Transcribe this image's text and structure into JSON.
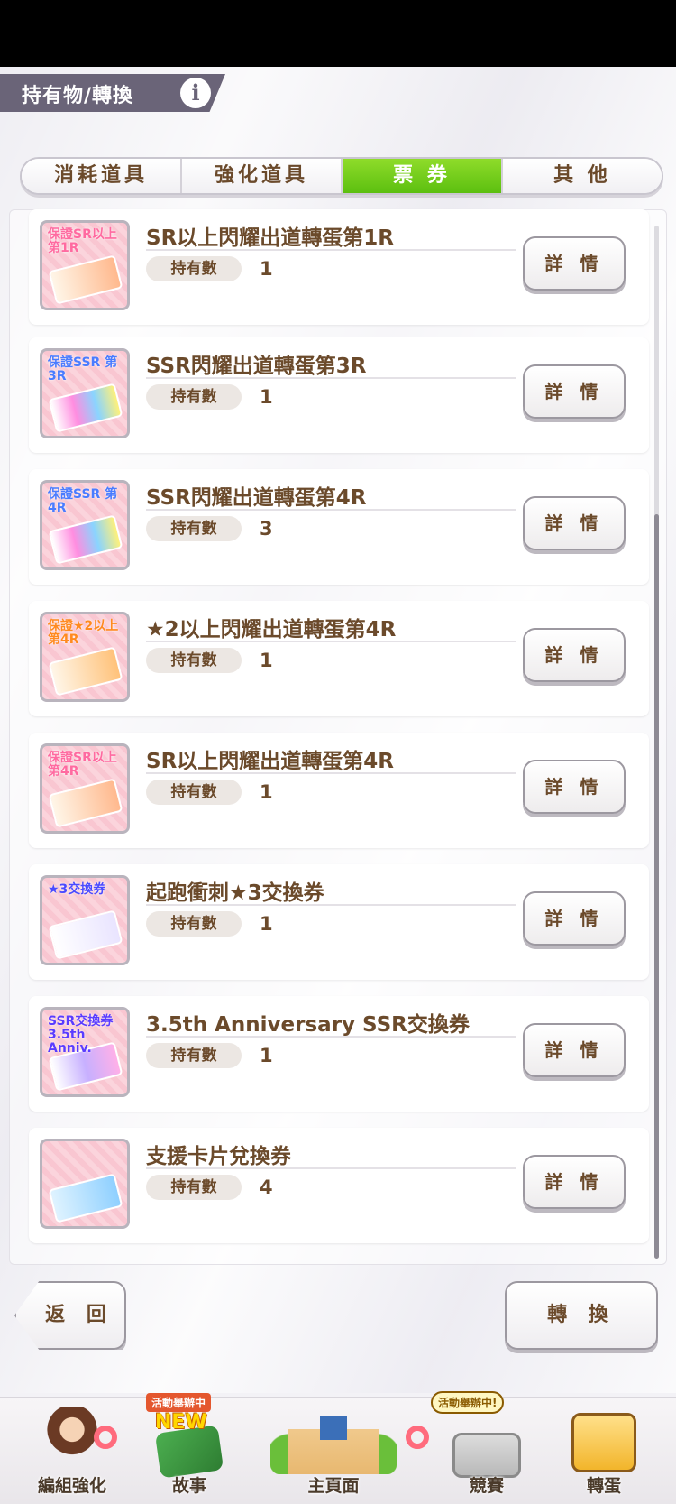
{
  "header": {
    "title": "持有物/轉換",
    "info_icon": "i"
  },
  "tabs": [
    {
      "label": "消耗道具",
      "active": false
    },
    {
      "label": "強化道具",
      "active": false
    },
    {
      "label": "票 券",
      "active": true
    },
    {
      "label": "其 他",
      "active": false
    }
  ],
  "items": [
    {
      "name": "SR以上閃耀出道轉蛋第1R",
      "qty_label": "持有數",
      "qty": "1",
      "detail": "詳 情",
      "thumb": "保證SR以上 第1R",
      "thumb_color": "#ff9f8a"
    },
    {
      "name": "SSR閃耀出道轉蛋第3R",
      "qty_label": "持有數",
      "qty": "1",
      "detail": "詳 情",
      "thumb": "保證SSR 第3R",
      "thumb_color": "#9f8cff"
    },
    {
      "name": "SSR閃耀出道轉蛋第4R",
      "qty_label": "持有數",
      "qty": "3",
      "detail": "詳 情",
      "thumb": "保證SSR 第4R",
      "thumb_color": "#9f8cff"
    },
    {
      "name": "★2以上閃耀出道轉蛋第4R",
      "qty_label": "持有數",
      "qty": "1",
      "detail": "詳 情",
      "thumb": "保證★2以上 第4R",
      "thumb_color": "#ffb36b"
    },
    {
      "name": "SR以上閃耀出道轉蛋第4R",
      "qty_label": "持有數",
      "qty": "1",
      "detail": "詳 情",
      "thumb": "保證SR以上 第4R",
      "thumb_color": "#ff9f8a"
    },
    {
      "name": "起跑衝刺★3交換券",
      "qty_label": "持有數",
      "qty": "1",
      "detail": "詳 情",
      "thumb": "★3交換券",
      "thumb_color": "#b8c2ff"
    },
    {
      "name": "3.5th Anniversary SSR交換券",
      "qty_label": "持有數",
      "qty": "1",
      "detail": "詳 情",
      "thumb": "SSR交換券 3.5th Anniv.",
      "thumb_color": "#c6a8ff"
    },
    {
      "name": "支援卡片兌換券",
      "qty_label": "持有數",
      "qty": "4",
      "detail": "詳 情",
      "thumb": "",
      "thumb_color": "#8fd0ff"
    }
  ],
  "buttons": {
    "back": "返 回",
    "convert": "轉 換"
  },
  "nav": [
    {
      "label": "編組強化",
      "icon": "trainer-character-icon"
    },
    {
      "label": "故事",
      "icon": "story-book-icon",
      "badge": "活動舉辦中",
      "new": "NEW"
    },
    {
      "label": "主頁面",
      "icon": "school-building-icon"
    },
    {
      "label": "競賽",
      "icon": "race-gate-icon",
      "badge": "活動舉辦中!"
    },
    {
      "label": "轉蛋",
      "icon": "gacha-gate-icon"
    }
  ],
  "colors": {
    "accent_green": "#6ccc16",
    "text_brown": "#6b4a2b",
    "header_bg": "#6a6478"
  }
}
